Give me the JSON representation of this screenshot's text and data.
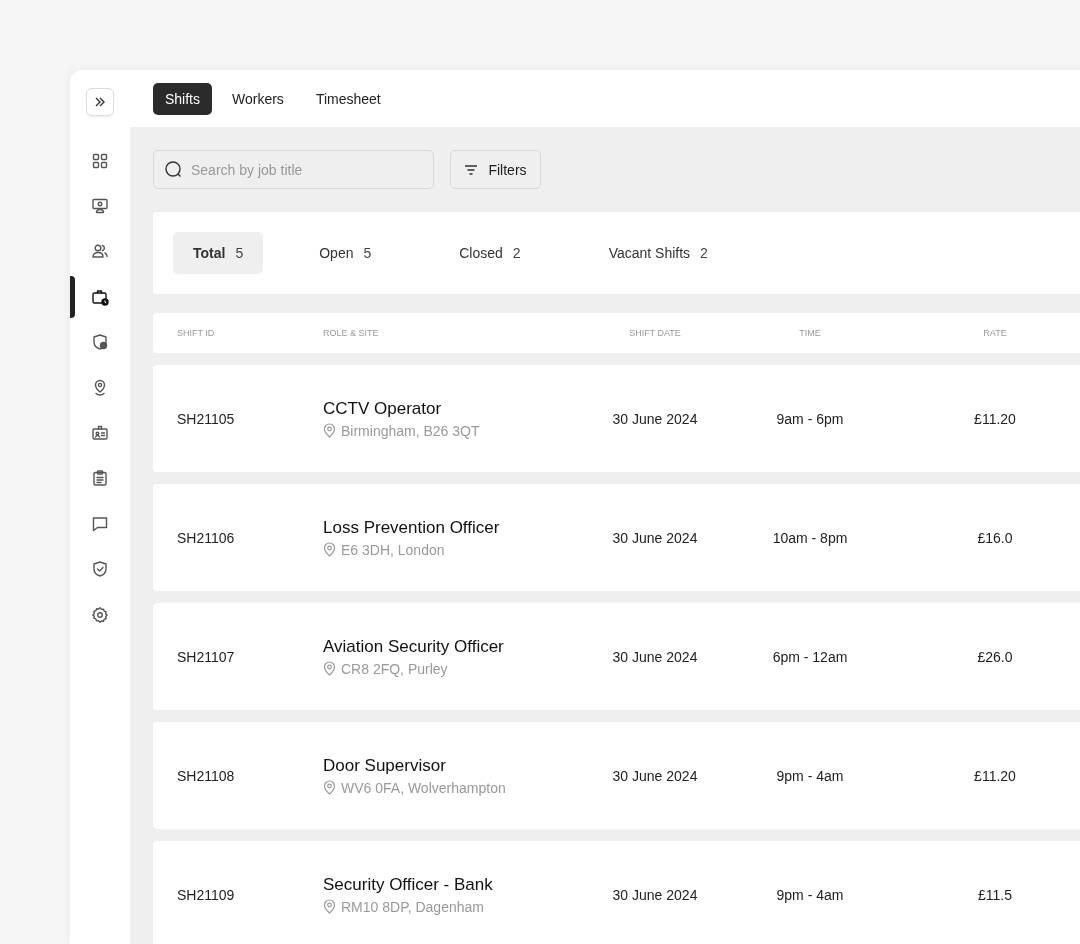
{
  "sidebar": {
    "items": [
      {
        "kind": "dashboard",
        "selected": false
      },
      {
        "kind": "monitor",
        "selected": false
      },
      {
        "kind": "people",
        "selected": false
      },
      {
        "kind": "shifts",
        "selected": true
      },
      {
        "kind": "shield-user",
        "selected": false
      },
      {
        "kind": "location",
        "selected": false
      },
      {
        "kind": "badge",
        "selected": false
      },
      {
        "kind": "clipboard",
        "selected": false
      },
      {
        "kind": "chat",
        "selected": false
      },
      {
        "kind": "shield-check",
        "selected": false
      },
      {
        "kind": "settings",
        "selected": false
      }
    ]
  },
  "tabs": [
    {
      "label": "Shifts",
      "selected": true
    },
    {
      "label": "Workers",
      "selected": false
    },
    {
      "label": "Timesheet",
      "selected": false
    }
  ],
  "search": {
    "placeholder": "Search by job title"
  },
  "filters_button": "Filters",
  "summary": [
    {
      "label": "Total",
      "count": "5",
      "selected": true
    },
    {
      "label": "Open",
      "count": "5",
      "selected": false
    },
    {
      "label": "Closed",
      "count": "2",
      "selected": false
    },
    {
      "label": "Vacant Shifts",
      "count": "2",
      "selected": false
    }
  ],
  "table": {
    "columns": [
      "SHIFT ID",
      "ROLE & SITE",
      "SHIFT DATE",
      "TIME",
      "RATE"
    ],
    "rows": [
      {
        "id": "SH21105",
        "role": "CCTV Operator",
        "site": "Birmingham, B26 3QT",
        "date": "30 June 2024",
        "time": "9am - 6pm",
        "rate": "£11.20"
      },
      {
        "id": "SH21106",
        "role": "Loss Prevention Officer",
        "site": "E6 3DH, London",
        "date": "30 June 2024",
        "time": "10am - 8pm",
        "rate": "£16.0"
      },
      {
        "id": "SH21107",
        "role": "Aviation Security Officer",
        "site": "CR8 2FQ, Purley",
        "date": "30 June 2024",
        "time": "6pm - 12am",
        "rate": "£26.0"
      },
      {
        "id": "SH21108",
        "role": "Door Supervisor",
        "site": "WV6 0FA, Wolverhampton",
        "date": "30 June 2024",
        "time": "9pm - 4am",
        "rate": "£11.20"
      },
      {
        "id": "SH21109",
        "role": "Security Officer - Bank",
        "site": "RM10 8DP, Dagenham",
        "date": "30 June 2024",
        "time": "9pm - 4am",
        "rate": "£11.5"
      }
    ]
  }
}
